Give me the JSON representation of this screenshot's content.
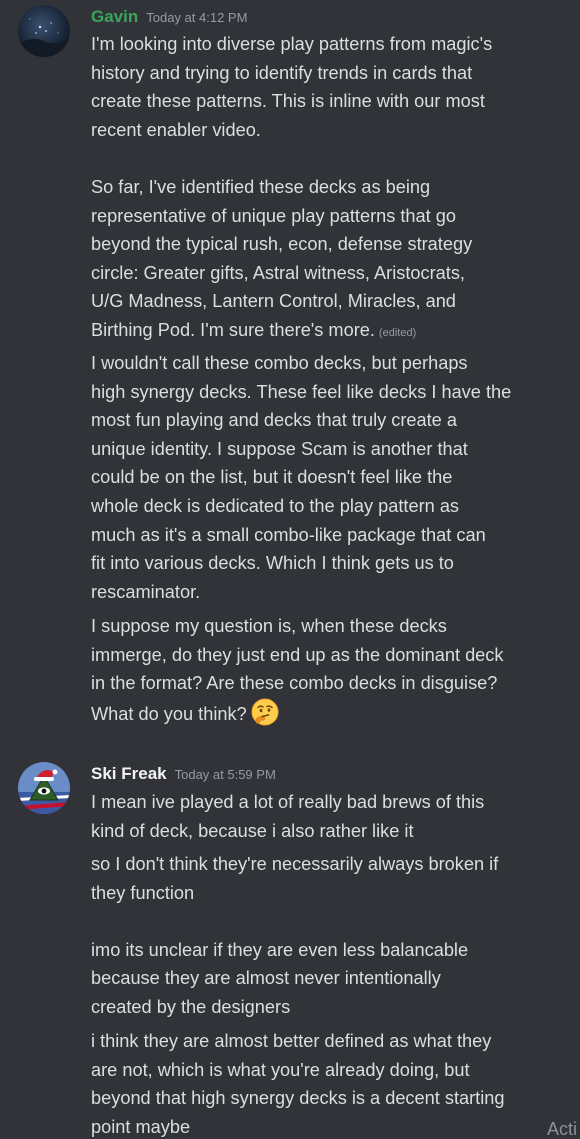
{
  "messages": [
    {
      "author": "Gavin",
      "author_color": "#3ba55d",
      "avatar_icon": "night-sky-avatar",
      "timestamp": "Today at 4:12 PM",
      "blocks": [
        {
          "lines": [
            "I'm looking into diverse play patterns from magic's",
            "history and trying to identify trends in cards that",
            "create these patterns. This is inline with our most",
            "recent enabler video.",
            "",
            "So far, I've identified these decks as being",
            "representative of unique play patterns that go",
            "beyond the typical rush, econ, defense strategy",
            "circle: Greater gifts, Astral witness, Aristocrats,",
            "U/G Madness, Lantern Control, Miracles, and",
            "Birthing Pod. I'm sure there's more."
          ],
          "edited": "(edited)"
        },
        {
          "lines": [
            "I wouldn't call these combo decks, but perhaps",
            "high synergy decks. These feel like decks I have the",
            "most fun playing and decks that truly create a",
            "unique identity. I suppose Scam is another that",
            "could be on the list, but it doesn't feel like the",
            "whole deck is dedicated to the play pattern as",
            "much as it's a small combo-like package that can",
            "fit into various decks. Which I think gets us to",
            "rescaminator."
          ]
        },
        {
          "lines": [
            "I suppose my question is, when these decks",
            "immerge, do they just end up as the dominant deck",
            "in the format? Are these combo decks in disguise?",
            "What do you think?"
          ],
          "emoji": "thinking-face"
        }
      ]
    },
    {
      "author": "Ski Freak",
      "author_color": "#f2f3f5",
      "avatar_icon": "eye-pyramid-santa-hat-avatar",
      "timestamp": "Today at 5:59 PM",
      "blocks": [
        {
          "lines": [
            "I mean ive played a lot of really bad brews of this",
            "kind of deck, because i also rather like it"
          ]
        },
        {
          "lines": [
            "so I don't think they're necessarily always broken if",
            "they function",
            "",
            "imo its unclear if they are even less balancable",
            "because they are almost never intentionally",
            "created by the designers"
          ]
        },
        {
          "lines": [
            "i think they are almost better defined as what they",
            "are not, which is what you're already doing, but",
            "beyond that high synergy decks is a decent starting",
            "point maybe"
          ]
        }
      ]
    }
  ],
  "watermark": "Acti"
}
